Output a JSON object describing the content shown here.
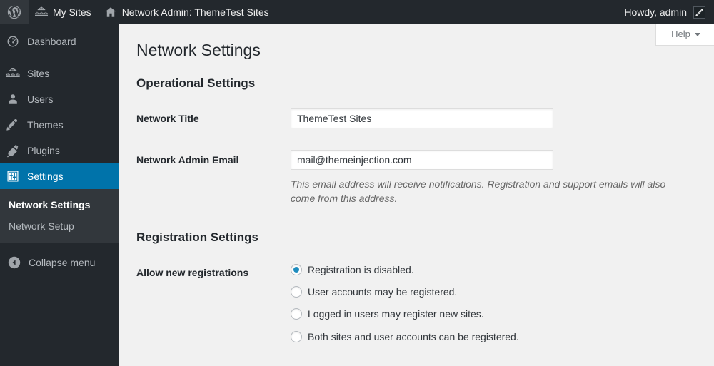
{
  "adminbar": {
    "wp_logo": "wordpress-logo-icon",
    "my_sites_label": "My Sites",
    "my_sites_icon": "my-sites-icon",
    "site_name_label": "Network Admin: ThemeTest Sites",
    "site_icon": "home-icon",
    "howdy_label": "Howdy, admin",
    "avatar": "avatar-placeholder-icon"
  },
  "sidebar": {
    "items": [
      {
        "label": "Dashboard",
        "icon": "dashboard-gauge-icon",
        "current": false
      },
      {
        "label": "Sites",
        "icon": "sites-network-icon",
        "current": false
      },
      {
        "label": "Users",
        "icon": "users-person-icon",
        "current": false
      },
      {
        "label": "Themes",
        "icon": "themes-brush-icon",
        "current": false
      },
      {
        "label": "Plugins",
        "icon": "plugins-plug-icon",
        "current": false
      },
      {
        "label": "Settings",
        "icon": "settings-sliders-icon",
        "current": true
      }
    ],
    "submenu": [
      {
        "label": "Network Settings",
        "current": true
      },
      {
        "label": "Network Setup",
        "current": false
      }
    ],
    "collapse_label": "Collapse menu",
    "collapse_icon": "collapse-arrow-left-icon",
    "current_color": "#0073aa"
  },
  "content": {
    "help_label": "Help",
    "help_caret_icon": "chevron-down-icon",
    "page_title": "Network Settings",
    "sections": [
      {
        "title": "Operational Settings",
        "fields": [
          {
            "label": "Network Title",
            "type": "text",
            "value": "ThemeTest Sites",
            "placeholder": ""
          },
          {
            "label": "Network Admin Email",
            "type": "text",
            "value": "mail@themeinjection.com",
            "placeholder": "",
            "description": "This email address will receive notifications. Registration and support emails will also come from this address."
          }
        ]
      },
      {
        "title": "Registration Settings",
        "fields": [
          {
            "label": "Allow new registrations",
            "type": "radio",
            "options": [
              {
                "label": "Registration is disabled.",
                "checked": true
              },
              {
                "label": "User accounts may be registered.",
                "checked": false
              },
              {
                "label": "Logged in users may register new sites.",
                "checked": false
              },
              {
                "label": "Both sites and user accounts can be registered.",
                "checked": false
              }
            ]
          }
        ]
      }
    ]
  },
  "colors": {
    "admin_bar_bg": "#23282d",
    "sidebar_bg": "#23282d",
    "submenu_bg": "#32373c",
    "accent_blue": "#0073aa",
    "radio_blue": "#1e8cbe",
    "content_bg": "#f1f1f1"
  }
}
